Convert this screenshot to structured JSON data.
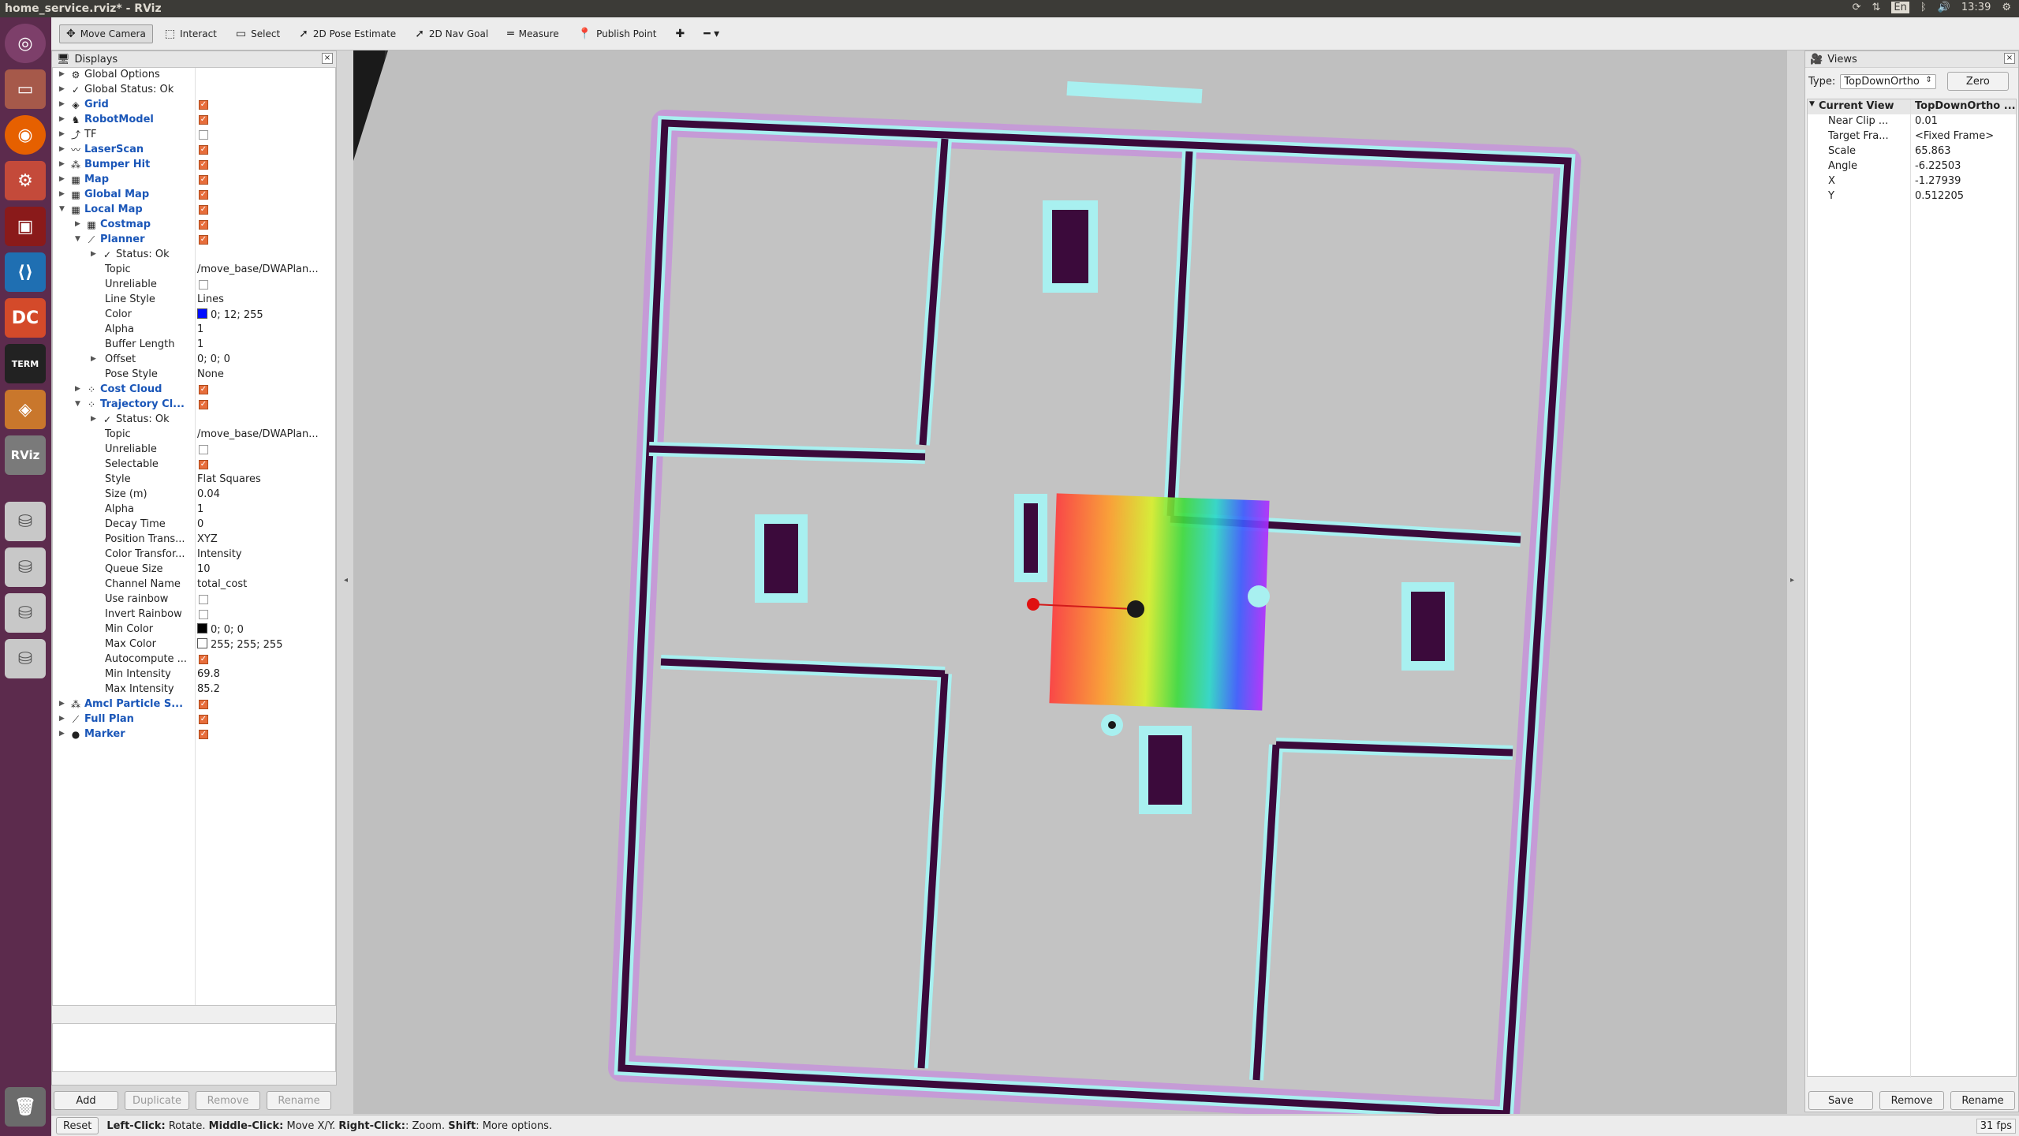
{
  "window": {
    "title": "home_service.rviz* - RViz",
    "clock": "13:39",
    "lang": "En"
  },
  "launcher": [
    "ubuntu-icon",
    "files-icon",
    "firefox-icon",
    "settings-icon",
    "terminal-red-icon",
    "vscode-icon",
    "dc-icon",
    "xterm-icon",
    "package-icon",
    "rviz-icon",
    "disk-icon",
    "disk-icon",
    "disk-icon",
    "disk-icon"
  ],
  "launcher_labels": {
    "rviz": "RViz",
    "dc": "DC",
    "term": "TERM"
  },
  "toolbar": [
    {
      "label": "Move Camera",
      "icon": "✥",
      "active": true
    },
    {
      "label": "Interact",
      "icon": "⬚"
    },
    {
      "label": "Select",
      "icon": "▭"
    },
    {
      "label": "2D Pose Estimate",
      "icon": "➚"
    },
    {
      "label": "2D Nav Goal",
      "icon": "➚"
    },
    {
      "label": "Measure",
      "icon": "═"
    },
    {
      "label": "Publish Point",
      "icon": "📍"
    },
    {
      "label": "",
      "icon": "✚"
    },
    {
      "label": "",
      "icon": "━ ▾"
    }
  ],
  "displays": {
    "title": "Displays",
    "rows": [
      {
        "indent": 0,
        "arrow": "▶",
        "icon": "⚙",
        "label": "Global Options",
        "blue": false
      },
      {
        "indent": 0,
        "arrow": "▶",
        "icon": "✓",
        "label": "Global Status: Ok",
        "blue": false
      },
      {
        "indent": 0,
        "arrow": "▶",
        "icon": "◈",
        "label": "Grid",
        "blue": true,
        "check": true
      },
      {
        "indent": 0,
        "arrow": "▶",
        "icon": "♞",
        "label": "RobotModel",
        "blue": true,
        "check": true
      },
      {
        "indent": 0,
        "arrow": "▶",
        "icon": "⤴",
        "label": "TF",
        "blue": false,
        "check": false
      },
      {
        "indent": 0,
        "arrow": "▶",
        "icon": "〰",
        "label": "LaserScan",
        "blue": true,
        "check": true
      },
      {
        "indent": 0,
        "arrow": "▶",
        "icon": "⁂",
        "label": "Bumper Hit",
        "blue": true,
        "check": true
      },
      {
        "indent": 0,
        "arrow": "▶",
        "icon": "▦",
        "label": "Map",
        "blue": true,
        "check": true
      },
      {
        "indent": 0,
        "arrow": "▶",
        "icon": "▦",
        "label": "Global Map",
        "blue": true,
        "check": true
      },
      {
        "indent": 0,
        "arrow": "▼",
        "icon": "▦",
        "label": "Local Map",
        "blue": true,
        "check": true
      },
      {
        "indent": 1,
        "arrow": "▶",
        "icon": "▦",
        "label": "Costmap",
        "blue": true,
        "check": true
      },
      {
        "indent": 1,
        "arrow": "▼",
        "icon": "⟋",
        "label": "Planner",
        "blue": true,
        "check": true
      },
      {
        "indent": 2,
        "arrow": "▶",
        "icon": "✓",
        "label": "Status: Ok",
        "blue": false
      },
      {
        "indent": 2,
        "arrow": "",
        "icon": "",
        "label": "Topic",
        "value": "/move_base/DWAPlan..."
      },
      {
        "indent": 2,
        "arrow": "",
        "icon": "",
        "label": "Unreliable",
        "check": false,
        "valcheck": true
      },
      {
        "indent": 2,
        "arrow": "",
        "icon": "",
        "label": "Line Style",
        "value": "Lines"
      },
      {
        "indent": 2,
        "arrow": "",
        "icon": "",
        "label": "Color",
        "value": "0; 12; 255",
        "swatch": "#000cff"
      },
      {
        "indent": 2,
        "arrow": "",
        "icon": "",
        "label": "Alpha",
        "value": "1"
      },
      {
        "indent": 2,
        "arrow": "",
        "icon": "",
        "label": "Buffer Length",
        "value": "1"
      },
      {
        "indent": 2,
        "arrow": "▶",
        "icon": "",
        "label": "Offset",
        "value": "0; 0; 0"
      },
      {
        "indent": 2,
        "arrow": "",
        "icon": "",
        "label": "Pose Style",
        "value": "None"
      },
      {
        "indent": 1,
        "arrow": "▶",
        "icon": "⁘",
        "label": "Cost Cloud",
        "blue": true,
        "check": true
      },
      {
        "indent": 1,
        "arrow": "▼",
        "icon": "⁘",
        "label": "Trajectory Cl...",
        "blue": true,
        "check": true
      },
      {
        "indent": 2,
        "arrow": "▶",
        "icon": "✓",
        "label": "Status: Ok",
        "blue": false
      },
      {
        "indent": 2,
        "arrow": "",
        "icon": "",
        "label": "Topic",
        "value": "/move_base/DWAPlan..."
      },
      {
        "indent": 2,
        "arrow": "",
        "icon": "",
        "label": "Unreliable",
        "check": false,
        "valcheck": true
      },
      {
        "indent": 2,
        "arrow": "",
        "icon": "",
        "label": "Selectable",
        "check": true,
        "valcheck": true
      },
      {
        "indent": 2,
        "arrow": "",
        "icon": "",
        "label": "Style",
        "value": "Flat Squares"
      },
      {
        "indent": 2,
        "arrow": "",
        "icon": "",
        "label": "Size (m)",
        "value": "0.04"
      },
      {
        "indent": 2,
        "arrow": "",
        "icon": "",
        "label": "Alpha",
        "value": "1"
      },
      {
        "indent": 2,
        "arrow": "",
        "icon": "",
        "label": "Decay Time",
        "value": "0"
      },
      {
        "indent": 2,
        "arrow": "",
        "icon": "",
        "label": "Position Trans...",
        "value": "XYZ"
      },
      {
        "indent": 2,
        "arrow": "",
        "icon": "",
        "label": "Color Transfor...",
        "value": "Intensity"
      },
      {
        "indent": 2,
        "arrow": "",
        "icon": "",
        "label": "Queue Size",
        "value": "10"
      },
      {
        "indent": 2,
        "arrow": "",
        "icon": "",
        "label": "Channel Name",
        "value": "total_cost"
      },
      {
        "indent": 2,
        "arrow": "",
        "icon": "",
        "label": "Use rainbow",
        "check": false,
        "valcheck": true
      },
      {
        "indent": 2,
        "arrow": "",
        "icon": "",
        "label": "Invert Rainbow",
        "check": false,
        "valcheck": true
      },
      {
        "indent": 2,
        "arrow": "",
        "icon": "",
        "label": "Min Color",
        "value": "0; 0; 0",
        "swatch": "#000000"
      },
      {
        "indent": 2,
        "arrow": "",
        "icon": "",
        "label": "Max Color",
        "value": "255; 255; 255",
        "swatch": "#ffffff"
      },
      {
        "indent": 2,
        "arrow": "",
        "icon": "",
        "label": "Autocompute ...",
        "check": true,
        "valcheck": true
      },
      {
        "indent": 2,
        "arrow": "",
        "icon": "",
        "label": "Min Intensity",
        "value": "69.8"
      },
      {
        "indent": 2,
        "arrow": "",
        "icon": "",
        "label": "Max Intensity",
        "value": "85.2"
      },
      {
        "indent": 0,
        "arrow": "▶",
        "icon": "⁂",
        "label": "Amcl Particle S...",
        "blue": true,
        "check": true
      },
      {
        "indent": 0,
        "arrow": "▶",
        "icon": "⟋",
        "label": "Full Plan",
        "blue": true,
        "check": true
      },
      {
        "indent": 0,
        "arrow": "▶",
        "icon": "●",
        "label": "Marker",
        "blue": true,
        "check": true
      }
    ],
    "buttons": [
      "Add",
      "Duplicate",
      "Remove",
      "Rename"
    ]
  },
  "views": {
    "title": "Views",
    "type_label": "Type:",
    "type_value": "TopDownOrtho",
    "zero_button": "Zero",
    "header": [
      "Current View",
      "TopDownOrtho ..."
    ],
    "rows": [
      [
        "Near Clip ...",
        "0.01"
      ],
      [
        "Target Fra...",
        "<Fixed Frame>"
      ],
      [
        "Scale",
        "65.863"
      ],
      [
        "Angle",
        "-6.22503"
      ],
      [
        "X",
        "-1.27939"
      ],
      [
        "Y",
        "0.512205"
      ]
    ],
    "buttons": [
      "Save",
      "Remove",
      "Rename"
    ]
  },
  "status": {
    "reset": "Reset",
    "hint_parts": [
      {
        "b": "Left-Click:",
        "t": " Rotate. "
      },
      {
        "b": "Middle-Click:",
        "t": " Move X/Y. "
      },
      {
        "b": "Right-Click:",
        "t": ": Zoom. "
      },
      {
        "b": "Shift",
        "t": ": More options."
      }
    ],
    "fps": "31 fps"
  }
}
